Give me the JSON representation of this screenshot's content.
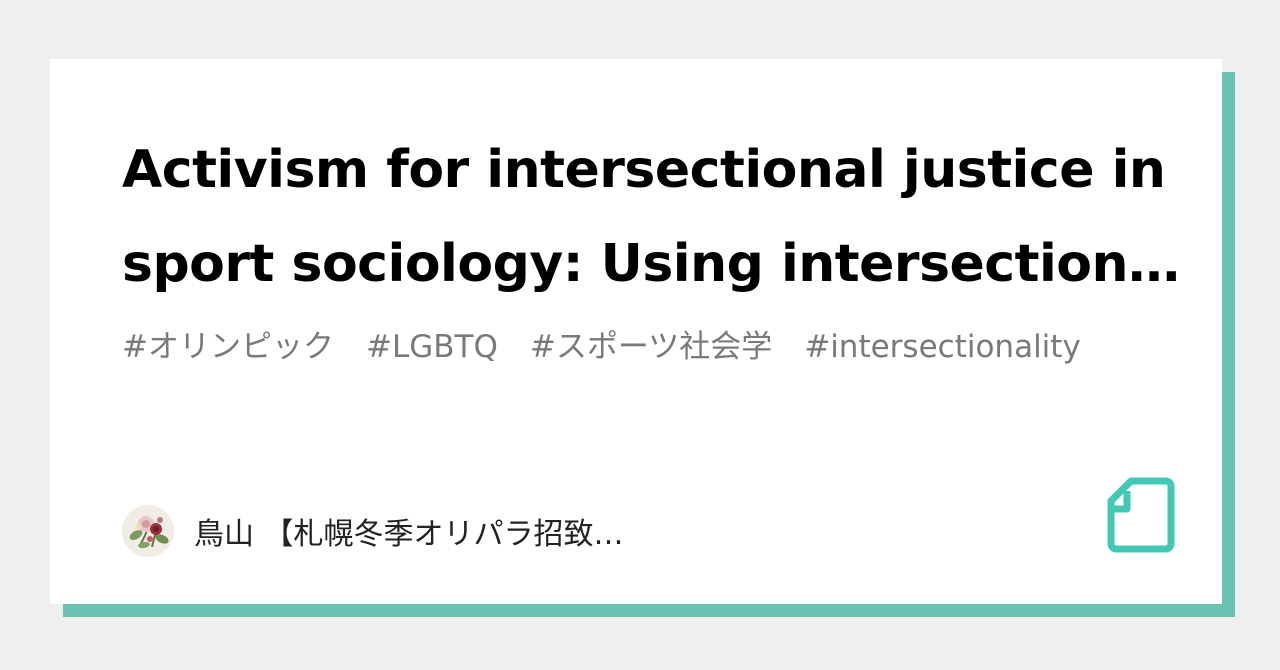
{
  "article": {
    "title": "Activism for intersectional justice in sport sociology: Using intersectionality as a critical praxis"
  },
  "tags": [
    "#オリンピック",
    "#LGBTQ",
    "#スポーツ社会学",
    "#intersectionality"
  ],
  "author": {
    "name": "鳥山 【札幌冬季オリパラ招致…"
  },
  "brand": {
    "logo_icon": "note-document-icon",
    "accent_color": "#41c9b4",
    "shadow_color": "#6bc3b4"
  }
}
